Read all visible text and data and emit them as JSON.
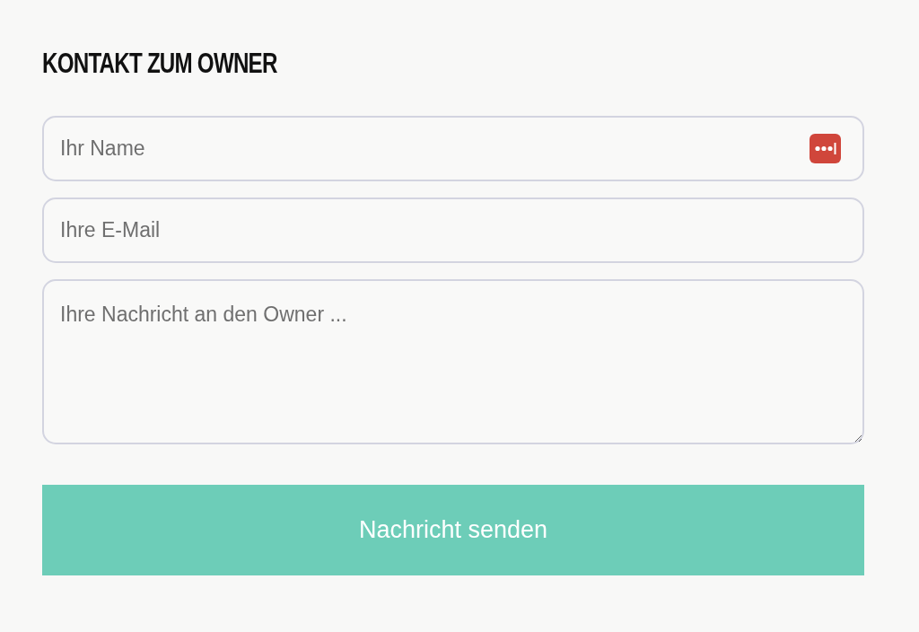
{
  "heading": "KONTAKT ZUM OWNER",
  "fields": [
    {
      "kind": "input",
      "placeholder": "Ihr Name",
      "autofill_icon": true
    },
    {
      "kind": "input",
      "placeholder": "Ihre E-Mail"
    },
    {
      "kind": "textarea",
      "placeholder": "Ihre Nachricht an den Owner ..."
    }
  ],
  "submit": {
    "label": "Nachricht senden"
  }
}
